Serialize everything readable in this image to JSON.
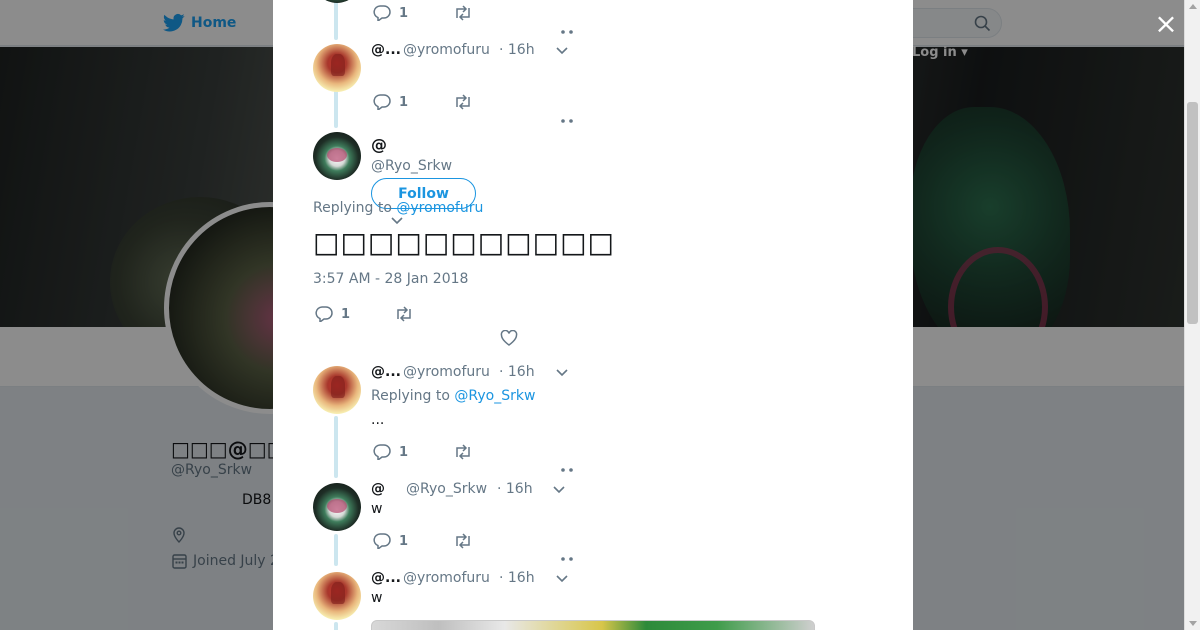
{
  "background": {
    "nav_home_label": "Home",
    "login_label": "Log in",
    "profile_name": "□□□@□□□□",
    "profile_handle": "@Ryo_Srkw",
    "bio_fragment": "DB8",
    "joined_label": "Joined July 2"
  },
  "close_label": "×",
  "thread": [
    {
      "type": "actions",
      "reply_count": "1"
    },
    {
      "type": "tweet",
      "name": "@...",
      "handle": "@yromofuru",
      "time": "· 16h",
      "reply_count": "1"
    },
    {
      "type": "focused",
      "name": "@",
      "handle": "@Ryo_Srkw",
      "follow_label": "Follow",
      "replying_label": "Replying to",
      "replying_handle": "@yromofuru",
      "text": "□□□□□□□□□□□",
      "timestamp": "3:57 AM - 28 Jan 2018",
      "reply_count": "1"
    },
    {
      "type": "tweet",
      "name": "@...",
      "handle": "@yromofuru",
      "time": "· 16h",
      "replying_label": "Replying to",
      "replying_handle": "@Ryo_Srkw",
      "text": "...",
      "reply_count": "1"
    },
    {
      "type": "tweet",
      "name": "@",
      "handle": "@Ryo_Srkw",
      "time": "· 16h",
      "text": "w",
      "reply_count": "1"
    },
    {
      "type": "tweet",
      "name": "@...",
      "handle": "@yromofuru",
      "time": "· 16h",
      "text": "w"
    }
  ],
  "colors": {
    "link": "#1b95e0",
    "muted": "#657786",
    "thread_line": "#cce6ef",
    "twitter_blue": "#1da1f2"
  }
}
